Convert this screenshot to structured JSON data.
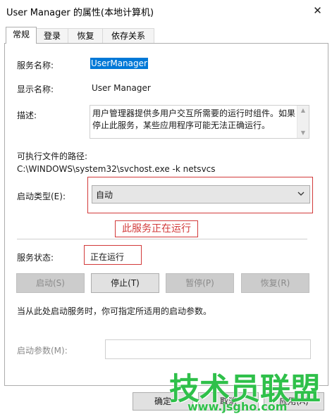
{
  "window": {
    "title": "User Manager 的属性(本地计算机)",
    "close_glyph": "✕"
  },
  "tabs": [
    {
      "label": "常规",
      "active": true
    },
    {
      "label": "登录",
      "active": false
    },
    {
      "label": "恢复",
      "active": false
    },
    {
      "label": "依存关系",
      "active": false
    }
  ],
  "general": {
    "service_name_label": "服务名称:",
    "service_name_value": "UserManager",
    "display_name_label": "显示名称:",
    "display_name_value": "User Manager",
    "description_label": "描述:",
    "description_value": "用户管理器提供多用户交互所需要的运行时组件。如果停止此服务，某些应用程序可能无法正确运行。",
    "exe_path_label": "可执行文件的路径:",
    "exe_path_value": "C:\\WINDOWS\\system32\\svchost.exe -k netsvcs",
    "startup_type_label": "启动类型(E):",
    "startup_type_value": "自动",
    "annotation": "此服务正在运行",
    "service_status_label": "服务状态:",
    "service_status_value": "正在运行",
    "buttons": {
      "start": "启动(S)",
      "stop": "停止(T)",
      "pause": "暂停(P)",
      "resume": "恢复(R)"
    },
    "hint": "当从此处启动服务时，你可指定所适用的启动参数。",
    "start_params_label": "启动参数(M):",
    "start_params_value": ""
  },
  "footer": {
    "ok": "确定",
    "cancel": "取消",
    "apply": "应用(A)"
  },
  "watermark": {
    "text": "技术员联盟",
    "url": "www.jsgho.com"
  },
  "colors": {
    "accent": "#0078d7",
    "annotation_red": "#d23a3a",
    "watermark_green": "#2fc04a"
  }
}
